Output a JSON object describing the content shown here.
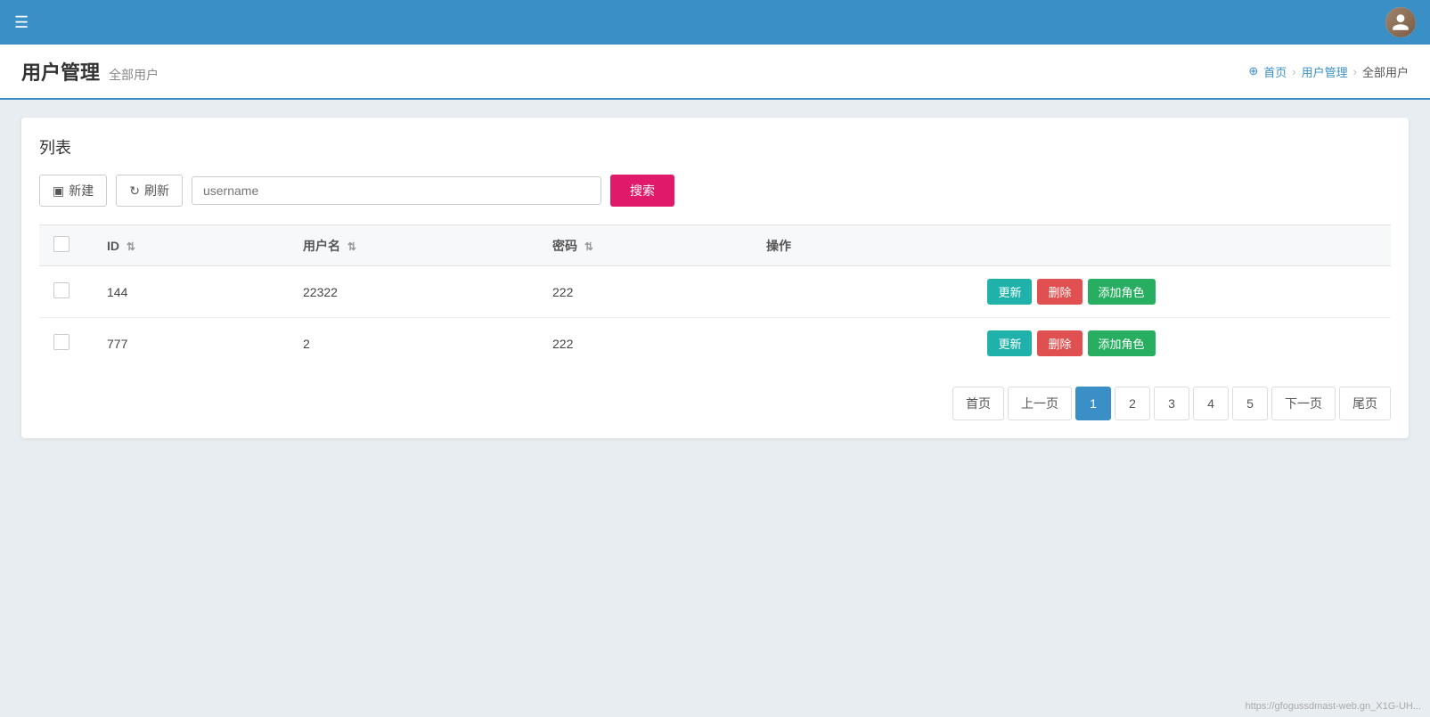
{
  "nav": {
    "hamburger_icon": "☰",
    "avatar_alt": "user avatar"
  },
  "header": {
    "title": "用户管理",
    "subtitle": "全部用户",
    "breadcrumb": {
      "home": "首页",
      "parent": "用户管理",
      "current": "全部用户"
    }
  },
  "card": {
    "title": "列表"
  },
  "toolbar": {
    "new_label": "新建",
    "refresh_label": "刷新",
    "search_placeholder": "username",
    "search_button_label": "搜索"
  },
  "table": {
    "columns": [
      {
        "id": "checkbox",
        "label": ""
      },
      {
        "id": "id",
        "label": "ID"
      },
      {
        "id": "username",
        "label": "用户名"
      },
      {
        "id": "password",
        "label": "密码"
      },
      {
        "id": "action",
        "label": "操作"
      }
    ],
    "rows": [
      {
        "id": "144",
        "username": "22322",
        "password": "222"
      },
      {
        "id": "777",
        "username": "2",
        "password": "222"
      }
    ],
    "action_buttons": {
      "update": "更新",
      "delete": "删除",
      "add_role": "添加角色"
    }
  },
  "pagination": {
    "first": "首页",
    "prev": "上一页",
    "pages": [
      "1",
      "2",
      "3",
      "4",
      "5"
    ],
    "next": "下一页",
    "last": "尾页",
    "active_page": "1"
  },
  "footer": {
    "url": "https://gfogussdmast-web.gn_X1G-UH..."
  },
  "colors": {
    "nav_bg": "#3a8fc7",
    "search_btn": "#e0196b",
    "update_btn": "#20b2aa",
    "delete_btn": "#e05050",
    "add_role_btn": "#27ae60"
  }
}
